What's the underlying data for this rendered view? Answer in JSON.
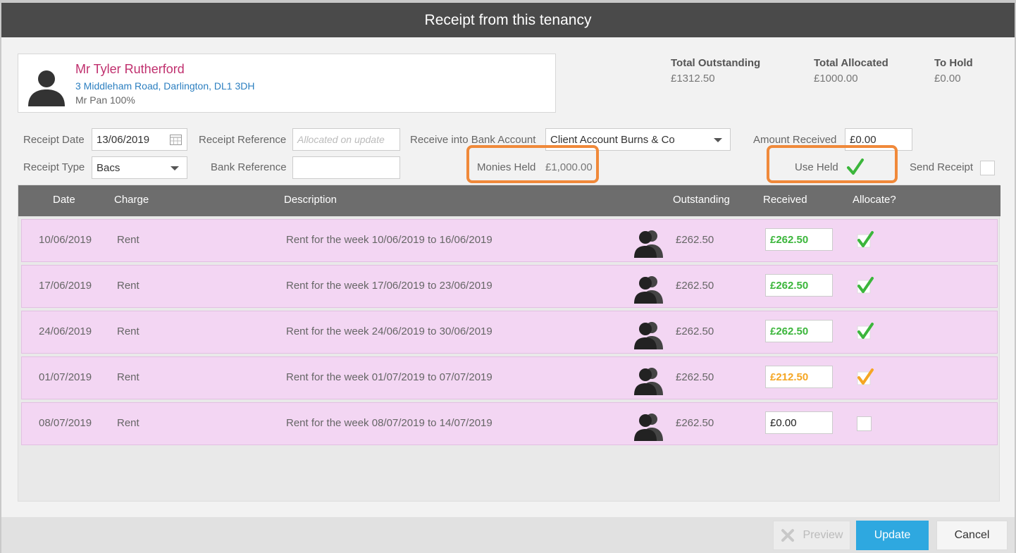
{
  "dialog": {
    "title": "Receipt from this tenancy"
  },
  "tenant": {
    "name": "Mr Tyler Rutherford",
    "address": "3 Middleham Road, Darlington, DL1 3DH",
    "share": "Mr Pan 100%"
  },
  "totals": {
    "outstanding_label": "Total Outstanding",
    "outstanding_value": "£1312.50",
    "allocated_label": "Total Allocated",
    "allocated_value": "£1000.00",
    "hold_label": "To Hold",
    "hold_value": "£0.00"
  },
  "form": {
    "receipt_date_label": "Receipt Date",
    "receipt_date_value": "13/06/2019",
    "receipt_reference_label": "Receipt Reference",
    "receipt_reference_placeholder": "Allocated on update",
    "bank_account_label": "Receive into Bank Account",
    "bank_account_value": "Client Account Burns & Co",
    "amount_received_label": "Amount Received",
    "amount_received_value": "£0.00",
    "receipt_type_label": "Receipt Type",
    "receipt_type_value": "Bacs",
    "bank_reference_label": "Bank Reference",
    "bank_reference_value": "",
    "monies_held_label": "Monies Held",
    "monies_held_value": "£1,000.00",
    "use_held_label": "Use Held",
    "use_held_checked": true,
    "send_receipt_label": "Send Receipt",
    "send_receipt_checked": false
  },
  "table": {
    "columns": [
      "Date",
      "Charge",
      "Description",
      "Outstanding",
      "Received",
      "Allocate?"
    ],
    "rows": [
      {
        "date": "10/06/2019",
        "charge": "Rent",
        "description": "Rent for the week 10/06/2019 to 16/06/2019",
        "outstanding": "£262.50",
        "received": "£262.50",
        "allocate": "green"
      },
      {
        "date": "17/06/2019",
        "charge": "Rent",
        "description": "Rent for the week 17/06/2019 to 23/06/2019",
        "outstanding": "£262.50",
        "received": "£262.50",
        "allocate": "green"
      },
      {
        "date": "24/06/2019",
        "charge": "Rent",
        "description": "Rent for the week 24/06/2019 to 30/06/2019",
        "outstanding": "£262.50",
        "received": "£262.50",
        "allocate": "green"
      },
      {
        "date": "01/07/2019",
        "charge": "Rent",
        "description": "Rent for the week 01/07/2019 to 07/07/2019",
        "outstanding": "£262.50",
        "received": "£212.50",
        "allocate": "orange"
      },
      {
        "date": "08/07/2019",
        "charge": "Rent",
        "description": "Rent for the week 08/07/2019 to 14/07/2019",
        "outstanding": "£262.50",
        "received": "£0.00",
        "allocate": "none"
      }
    ]
  },
  "footer": {
    "preview_label": "Preview",
    "update_label": "Update",
    "cancel_label": "Cancel"
  },
  "colors": {
    "title_bar": "#4a4a4a",
    "tenant_name": "#c0306e",
    "tenant_address": "#2c7fc0",
    "row_bg": "#f3d6f3",
    "received_full": "#3bb63b",
    "received_partial": "#f5a623",
    "highlight": "#f0893a",
    "update_button": "#2ea8e0"
  }
}
